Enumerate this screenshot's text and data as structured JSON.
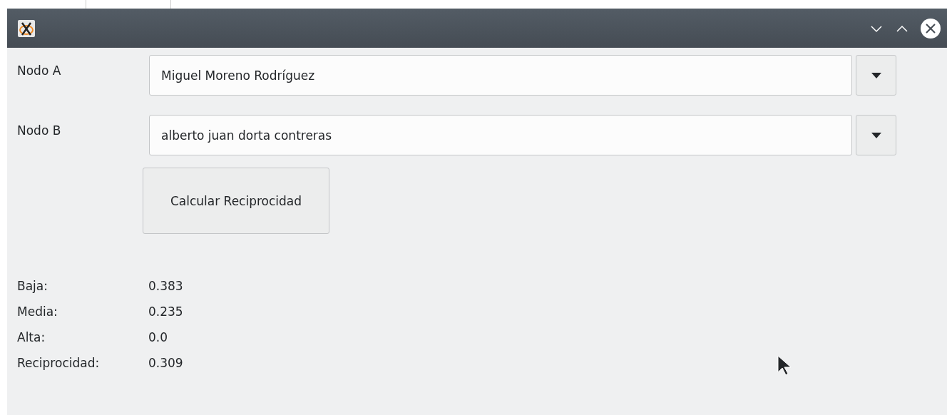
{
  "fields": [
    {
      "label": "Nodo A",
      "value": "Miguel Moreno Rodríguez"
    },
    {
      "label": "Nodo B",
      "value": "alberto juan dorta contreras"
    }
  ],
  "action_button": "Calcular Reciprocidad",
  "results": [
    {
      "label": "Baja:",
      "value": "0.383"
    },
    {
      "label": "Media:",
      "value": "0.235"
    },
    {
      "label": "Alta:",
      "value": "0.0"
    },
    {
      "label": "Reciprocidad:",
      "value": "0.309"
    }
  ]
}
